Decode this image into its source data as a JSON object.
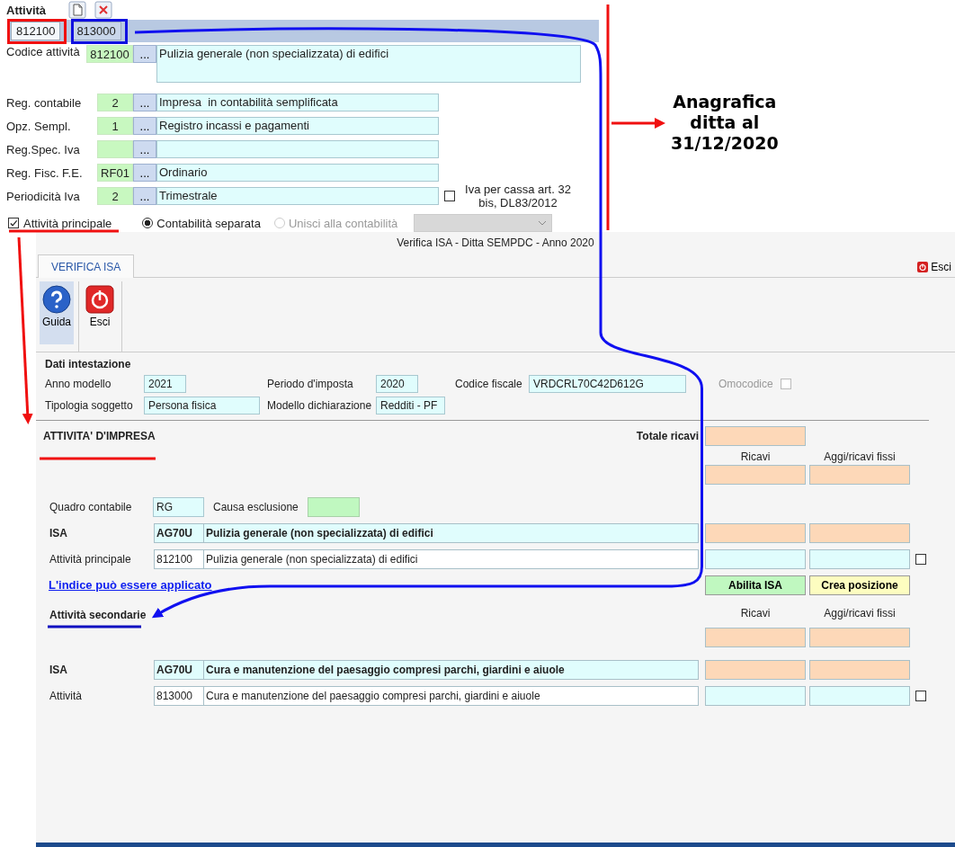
{
  "activity_panel": {
    "title": "Attività",
    "tabs": [
      {
        "label": "812100",
        "selected": true
      },
      {
        "label": "813000",
        "selected": false
      }
    ],
    "rows": [
      {
        "kind": "multiline",
        "label": "Codice attività",
        "code": "812100",
        "button": "...",
        "description": "Pulizia generale (non specializzata) di edifici"
      },
      {
        "kind": "single",
        "label": "Reg. contabile",
        "code": "2",
        "button": "...",
        "description": "Impresa  in contabilità semplificata"
      },
      {
        "kind": "single",
        "label": "Opz. Sempl.",
        "code": "1",
        "button": "...",
        "description": "Registro incassi e pagamenti"
      },
      {
        "kind": "single",
        "label": "Reg.Spec. Iva",
        "button": "..."
      },
      {
        "kind": "single",
        "label": "Reg. Fisc. F.E.",
        "code": "RF01",
        "button": "...",
        "description": "Ordinario"
      },
      {
        "kind": "single",
        "label": "Periodicità Iva",
        "code": "2",
        "button": "...",
        "description": "Trimestrale"
      }
    ],
    "iva_cassa": {
      "label": "Iva per cassa art. 32 bis, DL83/2012",
      "checked": false
    },
    "main_activity": {
      "label": "Attività principale",
      "checked": true
    },
    "radios": [
      {
        "label": "Contabilità separata",
        "selected": true,
        "disabled": false
      },
      {
        "label": "Unisci alla contabilità",
        "selected": false,
        "disabled": true
      }
    ]
  },
  "annotation": {
    "lines": [
      "Anagrafica",
      "ditta al",
      "31/12/2020"
    ]
  },
  "window": {
    "title": "Verifica ISA - Ditta SEMPDC - Anno 2020",
    "tabs": [
      {
        "label": "VERIFICA ISA",
        "selected": true
      }
    ],
    "close_label": "Esci",
    "toolbar": [
      {
        "kind": "help",
        "label": "Guida",
        "selected": true
      },
      {
        "kind": "exit",
        "label": "Esci",
        "selected": false
      }
    ]
  },
  "header": {
    "title": "Dati intestazione",
    "rows": [
      [
        {
          "label": "Anno modello",
          "value": "2021"
        },
        {
          "label": "Periodo d'imposta",
          "value": "2020"
        },
        {
          "label": "Codice fiscale",
          "value": "VRDCRL70C42D612G"
        }
      ],
      [
        {
          "label": "Tipologia soggetto",
          "value": "Persona fisica"
        },
        {
          "label": "Modello dichiarazione",
          "value": "Redditi - PF"
        }
      ]
    ],
    "omocodice": {
      "label": "Omocodice",
      "checked": false,
      "disabled": true
    }
  },
  "impresa": {
    "title": "ATTIVITA' D'IMPRESA",
    "total_label": "Totale ricavi",
    "columns": [
      "Ricavi",
      "Aggi/ricavi fissi"
    ],
    "quadro": {
      "label": "Quadro contabile",
      "value": "RG"
    },
    "causa": {
      "label": "Causa esclusione"
    },
    "rows": [
      {
        "kind": "isa",
        "label": "ISA",
        "code": "AG70U",
        "description": "Pulizia generale (non specializzata) di edifici"
      },
      {
        "kind": "activity",
        "label": "Attività principale",
        "code": "812100",
        "description": "Pulizia generale (non specializzata) di edifici",
        "checked": false
      }
    ],
    "link": "L'indice può essere applicato",
    "buttons": [
      {
        "kind": "enable",
        "label": "Abilita ISA"
      },
      {
        "kind": "create",
        "label": "Crea posizione"
      }
    ]
  },
  "secondary": {
    "title": "Attività secondarie",
    "columns": [
      "Ricavi",
      "Aggi/ricavi fissi"
    ],
    "rows": [
      {
        "kind": "isa",
        "label": "ISA",
        "code": "AG70U",
        "description": "Cura e manutenzione del paesaggio compresi parchi, giardini e aiuole"
      },
      {
        "kind": "activity",
        "label": "Attività",
        "code": "813000",
        "description": "Cura e manutenzione del paesaggio compresi parchi, giardini e aiuole",
        "checked": false
      }
    ]
  }
}
